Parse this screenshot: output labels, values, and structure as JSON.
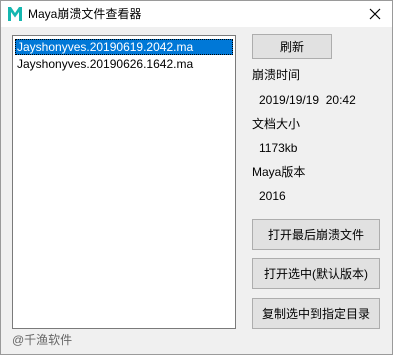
{
  "window": {
    "title": "Maya崩溃文件查看器",
    "icon": "maya-m-logo-icon",
    "close_icon": "close-x-icon",
    "accent_color": "#0078d7",
    "icon_color": "#15b7b0"
  },
  "file_list": {
    "items": [
      {
        "name": "Jayshonyves.20190619.2042.ma",
        "selected": true
      },
      {
        "name": "Jayshonyves.20190626.1642.ma",
        "selected": false
      }
    ]
  },
  "refresh_button": {
    "label": "刷新"
  },
  "info": {
    "crash_time_label": "崩溃时间",
    "crash_time_value": "2019/19/19  20:42",
    "file_size_label": "文档大小",
    "file_size_value": "1173kb",
    "maya_version_label": "Maya版本",
    "maya_version_value": "2016"
  },
  "actions": {
    "open_latest": "打开最后崩溃文件",
    "open_selected": "打开选中(默认版本)",
    "copy_selected": "复制选中到指定目录"
  },
  "footer": {
    "text": "@千渔软件"
  }
}
